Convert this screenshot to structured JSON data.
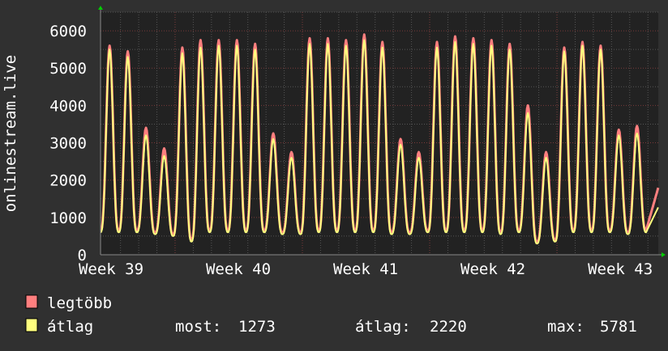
{
  "chart_data": {
    "type": "line",
    "title": "",
    "ylabel": "onlinestream.live",
    "xlabel": "",
    "xunit": "days",
    "xlim": [
      0,
      30.67
    ],
    "ylim": [
      0,
      6500
    ],
    "grid": true,
    "y_ticks": [
      0,
      1000,
      2000,
      3000,
      4000,
      5000,
      6000
    ],
    "y_tick_labels": [
      "0",
      "1000",
      "2000",
      "3000",
      "4000",
      "5000",
      "6000"
    ],
    "x_ticks": [
      0.58,
      7.58,
      14.58,
      21.58,
      28.58
    ],
    "x_tick_labels": [
      "Week 39",
      "Week 40",
      "Week 41",
      "Week 42",
      "Week 43"
    ],
    "week_boundaries": [
      4.1,
      11.1,
      18.1,
      25.1
    ],
    "series": [
      {
        "name": "legtöbb",
        "color": "#ff7f7f",
        "daily_peaks": [
          5600,
          5450,
          3400,
          2850,
          5550,
          5750,
          5750,
          5750,
          5650,
          3250,
          2750,
          5800,
          5800,
          5750,
          5900,
          5700,
          3100,
          2750,
          5700,
          5850,
          5800,
          5750,
          5650,
          4000,
          2750,
          5550,
          5700,
          5600,
          3350,
          3450
        ],
        "daily_troughs": [
          650,
          650,
          650,
          600,
          550,
          400,
          650,
          650,
          650,
          650,
          600,
          600,
          650,
          650,
          650,
          650,
          600,
          600,
          650,
          650,
          650,
          650,
          600,
          650,
          350,
          400,
          650,
          650,
          650,
          600,
          650
        ],
        "last_value": 1800
      },
      {
        "name": "átlag",
        "color": "#ffff7f",
        "daily_peaks": [
          5500,
          5300,
          3200,
          2650,
          5400,
          5550,
          5600,
          5600,
          5500,
          3100,
          2600,
          5650,
          5650,
          5600,
          5750,
          5550,
          2950,
          2600,
          5550,
          5700,
          5650,
          5600,
          5500,
          3800,
          2600,
          5450,
          5600,
          5500,
          3200,
          3250
        ],
        "daily_troughs": [
          600,
          600,
          600,
          550,
          500,
          350,
          600,
          600,
          600,
          600,
          550,
          550,
          600,
          600,
          600,
          600,
          550,
          550,
          600,
          600,
          600,
          600,
          550,
          600,
          300,
          350,
          600,
          600,
          600,
          550,
          600
        ],
        "last_value": 1273
      }
    ],
    "legend_position": "bottom-left",
    "stats": {
      "most_label": "most:",
      "most": "1273",
      "avg_label": "átlag:",
      "avg": "2220",
      "max_label": "max:",
      "max": "5781"
    }
  },
  "legend": {
    "items": [
      {
        "label": "legtöbb",
        "color": "#ff7f7f"
      },
      {
        "label": "átlag",
        "color": "#ffff7f"
      }
    ]
  },
  "colors": {
    "background": "#303030",
    "canvas": "#222222",
    "grid_minor": "#555555",
    "grid_major": "#7a3a3a",
    "arrow": "#00cc00"
  }
}
